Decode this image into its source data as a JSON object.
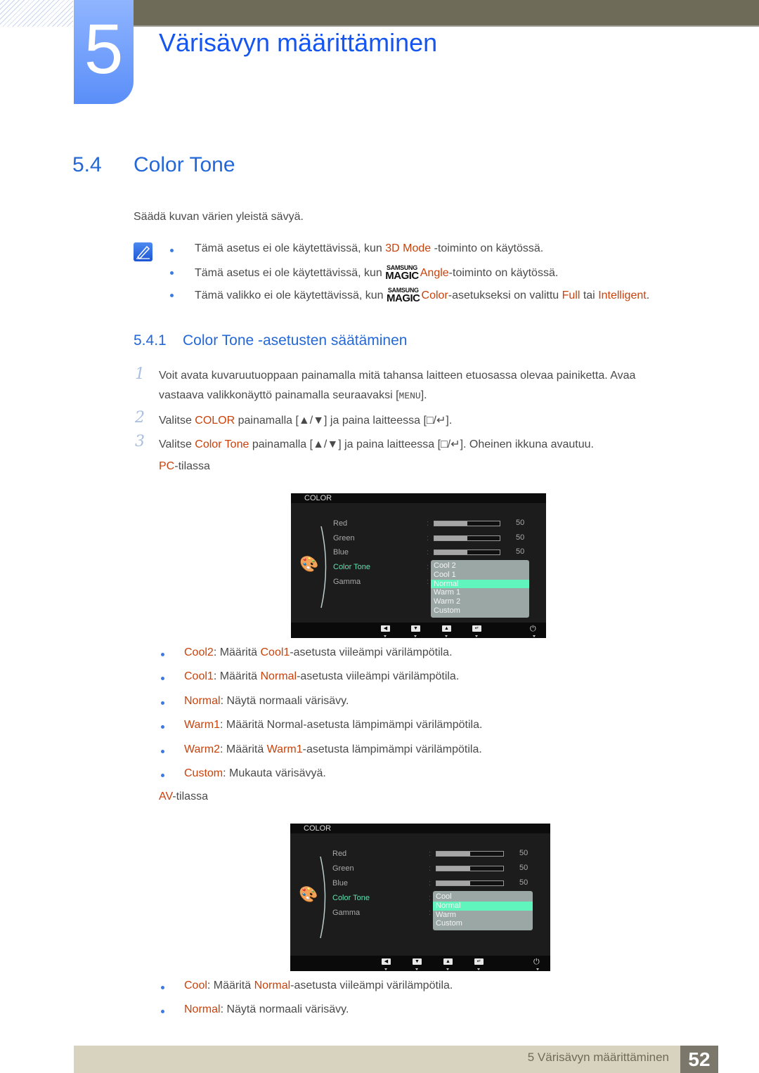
{
  "header": {
    "chapter_number": "5",
    "chapter_title": "Värisävyn määrittäminen"
  },
  "section": {
    "number": "5.4",
    "title": "Color Tone",
    "intro": "Säädä kuvan värien yleistä sävyä."
  },
  "notes": [
    [
      [
        "Tämä asetus ei ole käytettävissä, kun ",
        ""
      ],
      [
        "3D Mode",
        "o"
      ],
      [
        " -toiminto on käytössä.",
        ""
      ]
    ],
    [
      [
        "Tämä asetus ei ole käytettävissä, kun ",
        ""
      ],
      [
        "SAMSUNG MAGIC",
        "magic"
      ],
      [
        "Angle",
        "o"
      ],
      [
        "-toiminto on käytössä.",
        ""
      ]
    ],
    [
      [
        "Tämä valikko ei ole käytettävissä, kun ",
        ""
      ],
      [
        "SAMSUNG MAGIC",
        "magic"
      ],
      [
        "Color",
        "o"
      ],
      [
        "-asetukseksi on valittu ",
        ""
      ],
      [
        "Full",
        "o"
      ],
      [
        " tai ",
        ""
      ],
      [
        "Intelligent",
        "o"
      ],
      [
        ".",
        ""
      ]
    ]
  ],
  "subsection": {
    "number": "5.4.1",
    "title": "Color Tone -asetusten säätäminen"
  },
  "steps": [
    {
      "n": "1",
      "lines": [
        [
          [
            "Voit avata kuvaruutuoppaan painamalla mitä tahansa laitteen etuosassa olevaa painiketta. Avaa",
            ""
          ]
        ],
        [
          [
            "vastaava valikkonäyttö painamalla seuraavaksi [",
            ""
          ],
          [
            "MENU",
            "kbd"
          ],
          [
            "].",
            ""
          ]
        ]
      ]
    },
    {
      "n": "2",
      "lines": [
        [
          [
            "Valitse ",
            ""
          ],
          [
            "COLOR",
            "o"
          ],
          [
            " painamalla [▲/▼] ja paina laitteessa [□/↵].",
            ""
          ]
        ]
      ]
    },
    {
      "n": "3",
      "lines": [
        [
          [
            "Valitse ",
            ""
          ],
          [
            "Color Tone",
            "o"
          ],
          [
            " painamalla [▲/▼] ja paina laitteessa [□/↵]. Oheinen ikkuna avautuu.",
            ""
          ]
        ]
      ]
    }
  ],
  "pc_mode": [
    [
      "PC",
      "o"
    ],
    [
      "-tilassa",
      ""
    ]
  ],
  "osd_pc": {
    "title": "COLOR",
    "items": [
      "Red",
      "Green",
      "Blue",
      "Color Tone",
      "Gamma"
    ],
    "values": [
      "50",
      "50",
      "50"
    ],
    "levels": [
      0.5,
      0.5,
      0.5
    ],
    "selected": "Color Tone",
    "options": [
      "Cool 2",
      "Cool 1",
      "Normal",
      "Warm 1",
      "Warm 2",
      "Custom"
    ],
    "highlighted": "Normal"
  },
  "pc_list": [
    [
      [
        "Cool2",
        "o"
      ],
      [
        ": Määritä ",
        ""
      ],
      [
        "Cool1",
        "o"
      ],
      [
        "-asetusta viileämpi värilämpötila.",
        ""
      ]
    ],
    [
      [
        "Cool1",
        "o"
      ],
      [
        ": Määritä ",
        ""
      ],
      [
        "Normal",
        "o"
      ],
      [
        "-asetusta viileämpi värilämpötila.",
        ""
      ]
    ],
    [
      [
        "Normal",
        "o"
      ],
      [
        ": Näytä normaali värisävy.",
        ""
      ]
    ],
    [
      [
        "Warm1",
        "o"
      ],
      [
        ": Määritä Normal-asetusta lämpimämpi värilämpötila.",
        ""
      ]
    ],
    [
      [
        "Warm2",
        "o"
      ],
      [
        ": Määritä ",
        ""
      ],
      [
        "Warm1",
        "o"
      ],
      [
        "-asetusta lämpimämpi värilämpötila.",
        ""
      ]
    ],
    [
      [
        "Custom",
        "o"
      ],
      [
        ": Mukauta värisävyä.",
        ""
      ]
    ]
  ],
  "av_mode": [
    [
      "AV",
      "o"
    ],
    [
      "-tilassa",
      ""
    ]
  ],
  "osd_av": {
    "title": "COLOR",
    "items": [
      "Red",
      "Green",
      "Blue",
      "Color Tone",
      "Gamma"
    ],
    "values": [
      "50",
      "50",
      "50"
    ],
    "levels": [
      0.5,
      0.5,
      0.5
    ],
    "selected": "Color Tone",
    "options": [
      "Cool",
      "Normal",
      "Warm",
      "Custom"
    ],
    "highlighted": "Normal"
  },
  "av_list": [
    [
      [
        "Cool",
        "o"
      ],
      [
        ": Määritä ",
        ""
      ],
      [
        "Normal",
        "o"
      ],
      [
        "-asetusta viileämpi värilämpötila.",
        ""
      ]
    ],
    [
      [
        "Normal",
        "o"
      ],
      [
        ": Näytä normaali värisävy.",
        ""
      ]
    ]
  ],
  "osd_buttons": [
    "left-icon",
    "down-icon",
    "up-icon",
    "enter-icon",
    "power-icon"
  ],
  "footer": {
    "text": "5 Värisävyn määrittäminen",
    "page": "52"
  },
  "colors": {
    "heading_blue": "#2468d8",
    "highlight_orange": "#c8420c",
    "osd_selected": "#5fe2b0",
    "osd_highlight": "#60f5bd"
  }
}
